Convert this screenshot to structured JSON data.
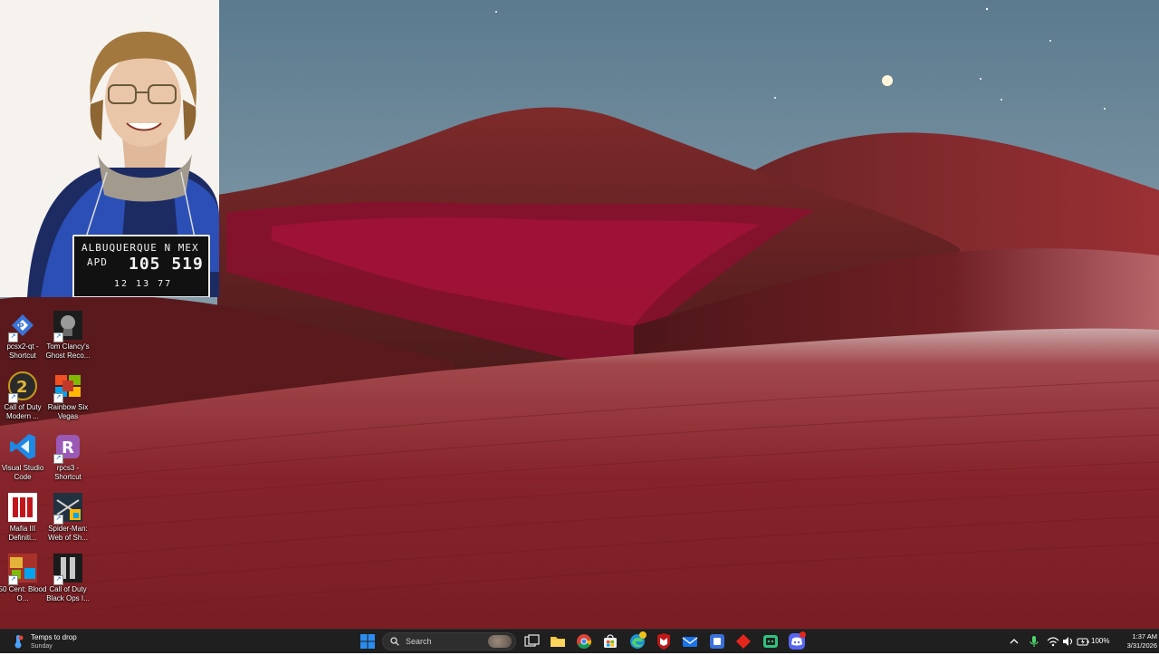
{
  "mugshot": {
    "placard_line1": "ALBUQUERQUE  N MEX",
    "placard_apd": "APD",
    "placard_number": "105 519",
    "placard_date": "12  13  77"
  },
  "desktop_icons": [
    {
      "label": "pcsx2-qt - Shortcut",
      "icon": "pcsx2-icon",
      "color": "#2f5fb0"
    },
    {
      "label": "Tom Clancy's Ghost Reco...",
      "icon": "ghost-recon-icon",
      "color": "#3a3a3a"
    },
    {
      "label": "Call of Duty Modern ...",
      "icon": "cod-modern-warfare-2-icon",
      "color": "#c79a1c"
    },
    {
      "label": "Rainbow Six Vegas",
      "icon": "rainbow-six-vegas-icon",
      "color": "#c0392b"
    },
    {
      "label": "Visual Studio Code",
      "icon": "vscode-icon",
      "color": "#1e88e5"
    },
    {
      "label": "rpcs3 - Shortcut",
      "icon": "rpcs3-icon",
      "color": "#8e44ad"
    },
    {
      "label": "Mafia III Definiti...",
      "icon": "mafia-iii-icon",
      "color": "#c0161c"
    },
    {
      "label": "Spider-Man: Web of Sh...",
      "icon": "spiderman-icon",
      "color": "#2c3e50"
    },
    {
      "label": "50 Cent: Blood O...",
      "icon": "50-cent-icon",
      "color": "#b03a2e"
    },
    {
      "label": "Call of Duty Black Ops I...",
      "icon": "cod-black-ops-icon",
      "color": "#3d3d3d"
    }
  ],
  "taskbar": {
    "weather": {
      "title": "Temps to drop",
      "subtitle": "Sunday"
    },
    "search_placeholder": "Search",
    "apps": [
      "start-icon",
      "search-icon",
      "task-view-icon",
      "file-explorer-icon",
      "chrome-icon",
      "microsoft-store-icon",
      "edge-icon",
      "mcafee-icon",
      "outlook-icon",
      "app-icon",
      "red-app-icon",
      "green-app-icon",
      "discord-icon"
    ],
    "tray": {
      "battery": "100%",
      "time": "1:37 AM",
      "date": "3/31/2026"
    }
  }
}
